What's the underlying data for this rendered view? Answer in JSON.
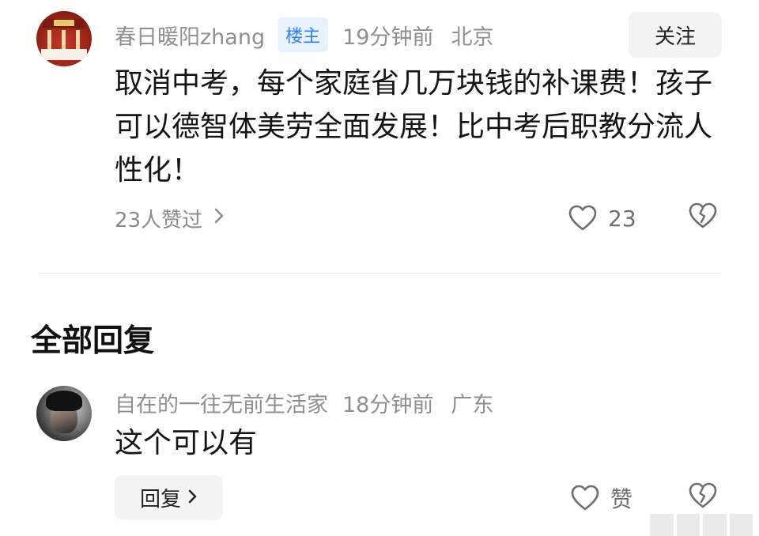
{
  "post": {
    "author": "春日暖阳zhang",
    "badge": "楼主",
    "time": "19分钟前",
    "location": "北京",
    "follow_label": "关注",
    "text": "取消中考，每个家庭省几万块钱的补课费！孩子可以德智体美劳全面发展！比中考后职教分流人性化！",
    "likers_label": "23人赞过",
    "like_count": "23"
  },
  "section": {
    "title": "全部回复"
  },
  "reply": {
    "author": "自在的一往无前生活家",
    "time": "18分钟前",
    "location": "广东",
    "text": "这个可以有",
    "reply_label": "回复",
    "like_label": "赞"
  },
  "icons": {
    "like": "heart-outline-icon",
    "dislike": "broken-heart-icon",
    "chevron": "chevron-right-icon"
  },
  "colors": {
    "badge_text": "#2d7ff5",
    "badge_bg": "#e8f2ff",
    "meta_text": "#8f8f8f"
  }
}
